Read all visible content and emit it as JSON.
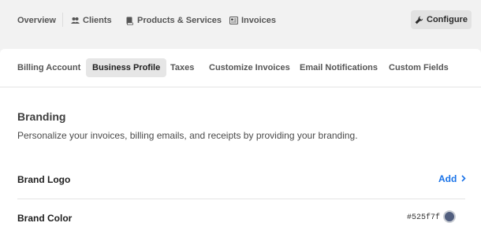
{
  "topnav": {
    "overview": "Overview",
    "clients": "Clients",
    "products": "Products & Services",
    "invoices": "Invoices",
    "configure": "Configure"
  },
  "tabs": [
    {
      "label": "Billing Account",
      "active": false
    },
    {
      "label": "Business Profile",
      "active": true
    },
    {
      "label": "Taxes",
      "active": false
    },
    {
      "label": "Customize Invoices",
      "active": false
    },
    {
      "label": "Email Notifications",
      "active": false
    },
    {
      "label": "Custom Fields",
      "active": false
    }
  ],
  "branding": {
    "title": "Branding",
    "description": "Personalize your invoices, billing emails, and receipts by providing your branding.",
    "logo_label": "Brand Logo",
    "logo_action": "Add",
    "color_label": "Brand Color",
    "color_value": "#525f7f"
  },
  "colors": {
    "link": "#1a73e8",
    "brand_swatch": "#525f7f"
  },
  "icons": {
    "clients": "users-icon",
    "products": "book-icon",
    "invoices": "invoice-icon",
    "configure": "wrench-icon",
    "add": "chevron-right-icon"
  }
}
